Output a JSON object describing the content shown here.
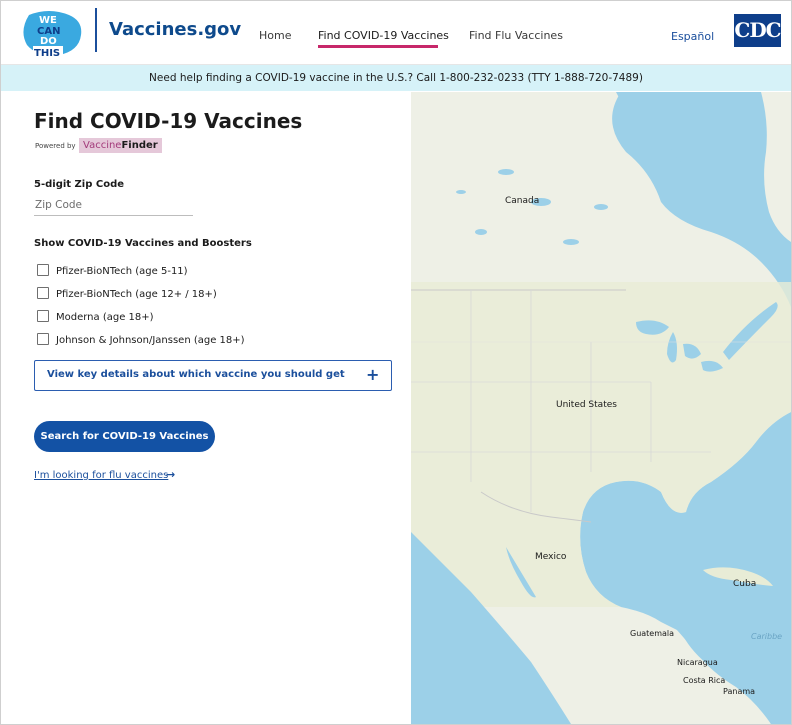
{
  "header": {
    "logo_text": [
      "WE",
      "CAN",
      "DO",
      "THIS"
    ],
    "site_name": "Vaccines.gov",
    "nav": [
      {
        "label": "Home"
      },
      {
        "label": "Find COVID-19 Vaccines"
      },
      {
        "label": "Find Flu Vaccines"
      }
    ],
    "espanol": "Español",
    "cdc_logo": "CDC"
  },
  "banner": {
    "text": "Need help finding a COVID-19 vaccine in the U.S.? Call 1-800-232-0233 (TTY 1-888-720-7489)"
  },
  "finder": {
    "title": "Find COVID-19 Vaccines",
    "powered_by": "Powered by",
    "vaccine_finder_a": "Vaccine",
    "vaccine_finder_b": "Finder",
    "zip_label": "5-digit Zip Code",
    "zip_placeholder": "Zip Code",
    "show_label": "Show COVID-19 Vaccines and Boosters",
    "options": [
      {
        "label": "Pfizer-BioNTech (age 5-11)"
      },
      {
        "label": "Pfizer-BioNTech (age 12+ / 18+)"
      },
      {
        "label": "Moderna (age 18+)"
      },
      {
        "label": "Johnson & Johnson/Janssen (age 18+)"
      }
    ],
    "details_label": "View key details about which vaccine you should get",
    "details_icon": "+",
    "search_button": "Search for COVID-19 Vaccines",
    "flu_link": "I'm looking for flu vaccines",
    "flu_arrow": "→"
  },
  "map": {
    "labels": {
      "canada": "Canada",
      "united_states": "United States",
      "mexico": "Mexico",
      "cuba": "Cuba",
      "guatemala": "Guatemala",
      "nicaragua": "Nicaragua",
      "costa_rica": "Costa Rica",
      "panama": "Panama",
      "caribbean": "Caribbe"
    },
    "colors": {
      "water": "#9cd0e8",
      "land": "#eef0e6",
      "land_south": "#e8ecd6",
      "forest": "#dde6cc"
    }
  }
}
